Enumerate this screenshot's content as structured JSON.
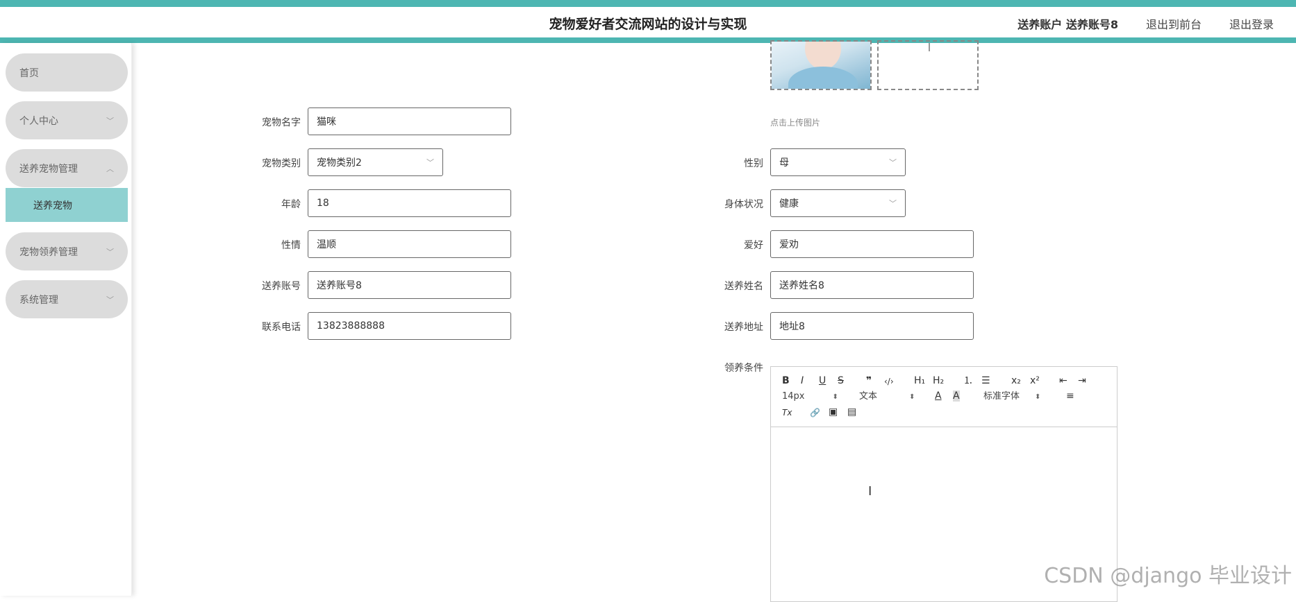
{
  "header": {
    "title": "宠物爱好者交流网站的设计与实现",
    "user_label": "送养账户 送养账号8",
    "front_link": "退出到前台",
    "logout_link": "退出登录"
  },
  "sidebar": {
    "items": [
      {
        "label": "首页"
      },
      {
        "label": "个人中心",
        "chevron": "﹀"
      },
      {
        "label": "送养宠物管理",
        "chevron": "︿"
      },
      {
        "label": "宠物领养管理",
        "chevron": "﹀"
      },
      {
        "label": "系统管理",
        "chevron": "﹀"
      }
    ],
    "submenu": {
      "label": "送养宠物"
    }
  },
  "upload": {
    "hint": "点击上传图片"
  },
  "form": {
    "pet_name": {
      "label": "宠物名字",
      "value": "猫咪"
    },
    "pet_type": {
      "label": "宠物类别",
      "value": "宠物类别2"
    },
    "gender": {
      "label": "性别",
      "value": "母"
    },
    "age": {
      "label": "年龄",
      "value": "18"
    },
    "health": {
      "label": "身体状况",
      "value": "健康"
    },
    "temper": {
      "label": "性情",
      "value": "温顺"
    },
    "hobby": {
      "label": "爱好",
      "value": "爱劝"
    },
    "account": {
      "label": "送养账号",
      "value": "送养账号8"
    },
    "name": {
      "label": "送养姓名",
      "value": "送养姓名8"
    },
    "phone": {
      "label": "联系电话",
      "value": "13823888888"
    },
    "address": {
      "label": "送养地址",
      "value": "地址8"
    },
    "conditions": {
      "label": "领养条件"
    }
  },
  "editor": {
    "font_size": "14px",
    "paragraph": "文本",
    "font_family": "标准字体",
    "updown_glyph": "⬍",
    "btn_bold": "B",
    "btn_italic": "I",
    "btn_underline": "U",
    "btn_strike": "S",
    "btn_quote": "❞",
    "btn_code": "‹/›",
    "btn_h1": "H₁",
    "btn_h2": "H₂",
    "btn_ol": "⒈",
    "btn_ul": "☰",
    "btn_sub": "x₂",
    "btn_sup": "x²",
    "btn_outdent": "⇤",
    "btn_indent": "⇥",
    "btn_color": "A",
    "btn_bg": "A",
    "btn_align": "≡",
    "btn_clear": "Tx",
    "btn_link": "🔗",
    "btn_image": "▣",
    "btn_video": "▤"
  },
  "watermark": "CSDN @django 毕业设计"
}
